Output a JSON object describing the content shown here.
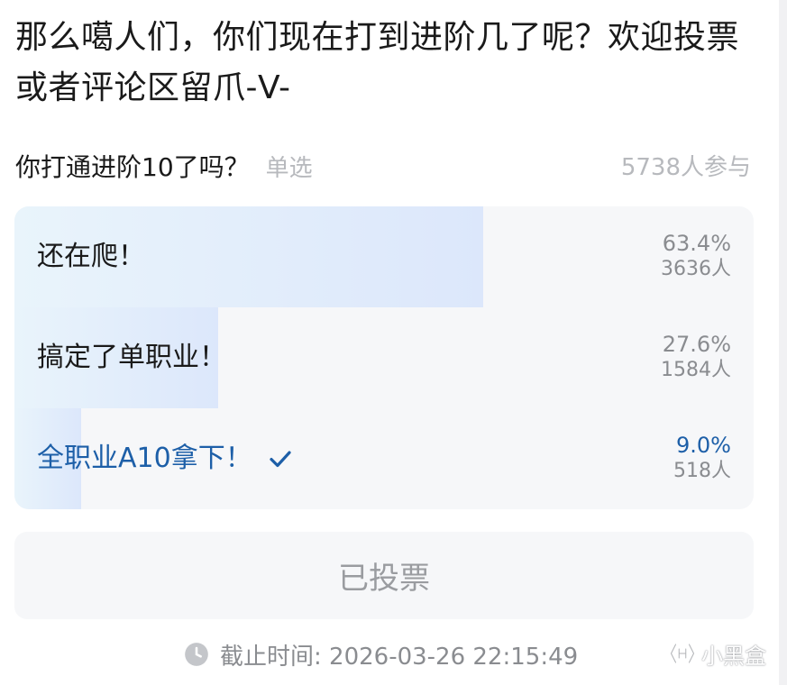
{
  "post": {
    "title": "那么噶人们，你们现在打到进阶几了呢？欢迎投票或者评论区留爪-V-"
  },
  "poll": {
    "question": "你打通进阶10了吗？",
    "type": "单选",
    "participants": "5738人参与",
    "options": [
      {
        "label": "还在爬！",
        "percent": "63.4%",
        "count": "3636人",
        "share": 0.634,
        "selected": false
      },
      {
        "label": "搞定了单职业！",
        "percent": "27.6%",
        "count": "1584人",
        "share": 0.276,
        "selected": false
      },
      {
        "label": "全职业A10拿下！",
        "percent": "9.0%",
        "count": "518人",
        "share": 0.09,
        "selected": true
      }
    ],
    "voted_label": "已投票",
    "deadline": "截止时间: 2026-03-26 22:15:49"
  },
  "watermark": {
    "text": "小黑盒"
  },
  "colors": {
    "selected": "#1d5fa8",
    "muted": "#8a8c90",
    "fill": "#dce7fb"
  },
  "icons": {
    "check": "check-icon",
    "clock": "clock-icon",
    "logo": "heybox-logo"
  }
}
